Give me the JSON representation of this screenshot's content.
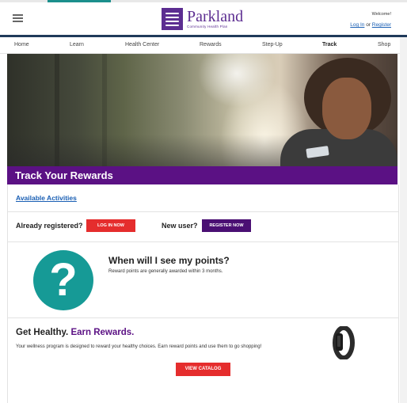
{
  "header": {
    "menu_icon": "hamburger-menu-icon",
    "logo_title": "Parkland",
    "logo_subtitle": "Community Health Plan",
    "welcome_text": "Welcome!",
    "login_link": "Log In",
    "or_text": "or",
    "register_link": "Register"
  },
  "nav": {
    "items": [
      "Home",
      "Learn",
      "Health Center",
      "Rewards",
      "Step-Up",
      "Track",
      "Shop"
    ],
    "active": "Track"
  },
  "banner": {
    "title": "Track Your Rewards"
  },
  "activities": {
    "link": "Available Activities"
  },
  "registration": {
    "existing_label": "Already registered?",
    "login_button": "LOG IN NOW",
    "new_label": "New user?",
    "register_button": "REGISTER NOW"
  },
  "points": {
    "icon": "question-mark-icon",
    "title": "When will I see my points?",
    "description": "Reward points are generally awarded within 3 months."
  },
  "rewards": {
    "title_plain": "Get Healthy.",
    "title_accent": "Earn Rewards.",
    "description": "Your wellness program is designed to reward your healthy choices. Earn reward points and use them to go shopping!",
    "catalog_button": "VIEW CATALOG",
    "image": "fitness-band-icon"
  },
  "colors": {
    "brand_purple": "#5b1184",
    "accent_red": "#e52d2d",
    "accent_teal": "#169a96",
    "link_blue": "#1a5fb4"
  }
}
